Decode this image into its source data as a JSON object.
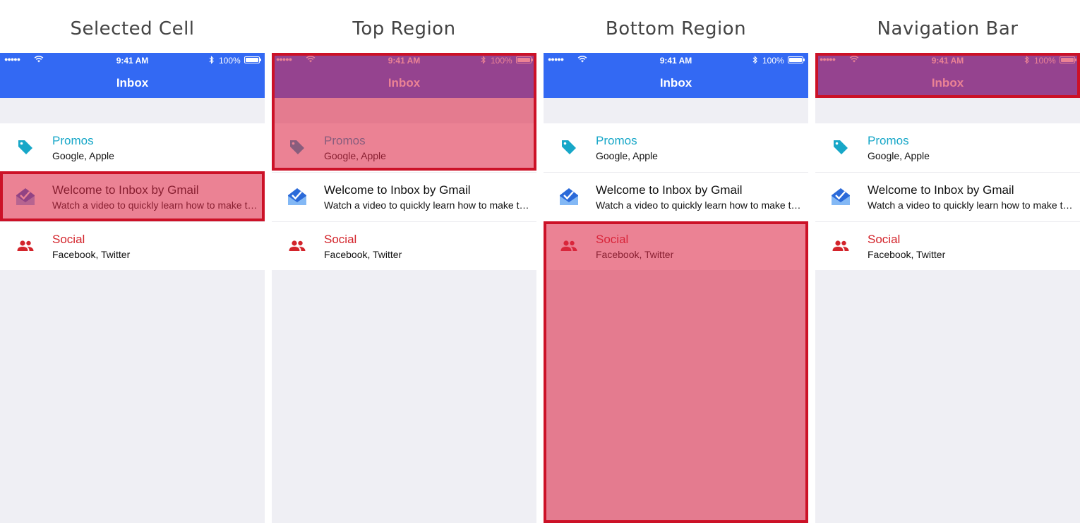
{
  "colors": {
    "nav_background": "#3369f3",
    "highlight_fill": "rgba(220,40,70,0.58)",
    "highlight_border": "#cc1127",
    "promos_accent": "#17a7c8",
    "social_accent": "#d3242b"
  },
  "panels": [
    {
      "title": "Selected Cell",
      "highlight": "welcome-cell"
    },
    {
      "title": "Top Region",
      "highlight": "navigation-bar-and-promos-cell"
    },
    {
      "title": "Bottom Region",
      "highlight": "social-cell-and-below"
    },
    {
      "title": "Navigation Bar",
      "highlight": "navigation-bar"
    }
  ],
  "status_bar": {
    "signal": "●●●●●",
    "wifi_icon": "wifi-icon",
    "time": "9:41 AM",
    "bluetooth_icon": "bluetooth-icon",
    "battery_percent": "100%",
    "battery_icon": "battery-icon"
  },
  "nav": {
    "title": "Inbox"
  },
  "cells": [
    {
      "icon": "tag-icon",
      "title": "Promos",
      "subtitle": "Google, Apple"
    },
    {
      "icon": "inbox-envelope-icon",
      "title": "Welcome to Inbox by Gmail",
      "subtitle": "Watch a video to quickly learn how to make t…"
    },
    {
      "icon": "people-icon",
      "title": "Social",
      "subtitle": "Facebook, Twitter"
    }
  ]
}
